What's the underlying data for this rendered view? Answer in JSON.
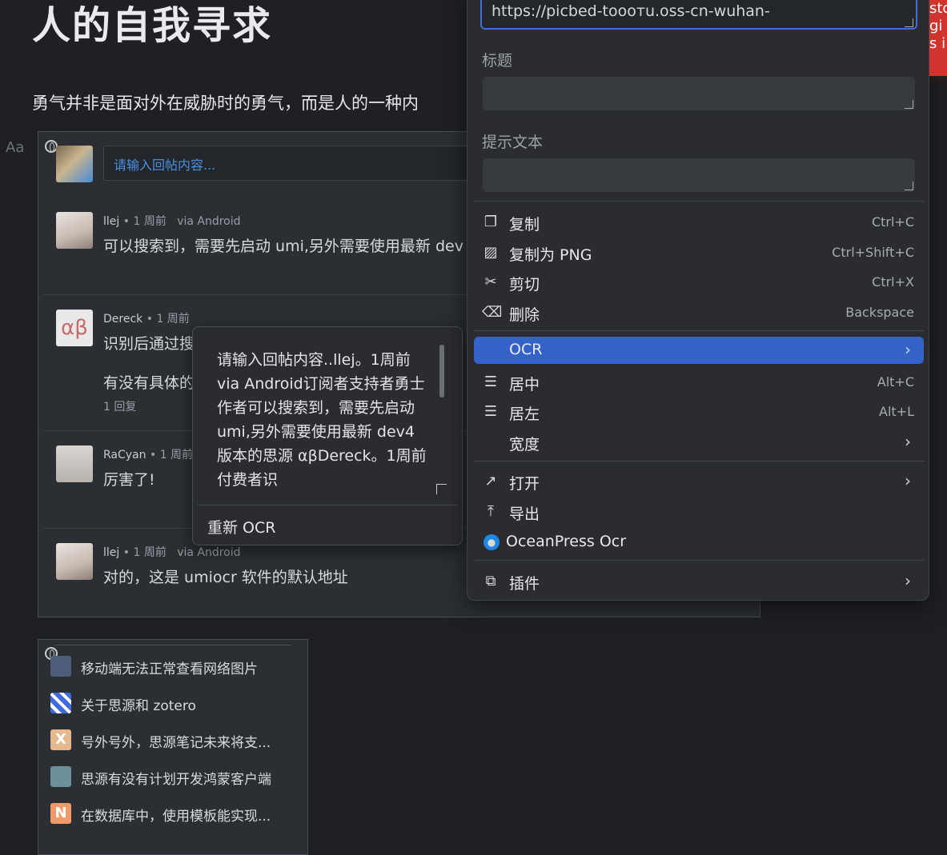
{
  "document": {
    "heading": "人的自我寻求",
    "paragraph": "勇气并非是面对外在威胁时的勇气，而是人的一种内",
    "font_size_indicator": "Aa"
  },
  "comments_embed": {
    "reply_placeholder": "请输入回帖内容...",
    "comments": [
      {
        "author": "llej",
        "time": "1 周前",
        "via": "via Android",
        "body": "可以搜索到，需要先启动 umi,另外需要使用最新 dev"
      },
      {
        "author": "Dereck",
        "time": "1 周前",
        "body": "识别后通过搜",
        "body2": "有没有具体的",
        "replies": "1 回复"
      },
      {
        "author": "RaCyan",
        "time": "1 周前",
        "body": "厉害了!"
      },
      {
        "author": "llej",
        "time": "1 周前",
        "via": "via Android",
        "body": "对的，这是 umiocr 软件的默认地址"
      }
    ]
  },
  "list_embed": {
    "items": [
      {
        "label": "移动端无法正常查看网络图片",
        "color": "#4d5d7a"
      },
      {
        "label": "关于思源和 zotero",
        "color": "#3f6bdc"
      },
      {
        "label": "号外号外，思源笔记未来将支...",
        "color": "#e5b98d",
        "letter": "X"
      },
      {
        "label": "思源有没有计划开发鸿蒙客户端",
        "color": "#6f8f9b"
      },
      {
        "label": "在数据库中，使用模板能实现...",
        "color": "#f09a6a",
        "letter": "N"
      }
    ]
  },
  "ocr_popup": {
    "text": "请输入回帖内容..llej。1周前via Android订阅者支持者勇士作者可以搜索到，需要先启动 umi,另外需要使用最新 dev4 版本的思源 αβDereck。1周前付费者识",
    "reocr_label": "重新 OCR"
  },
  "context_menu": {
    "url_value": "https://picbed-tooотu.oss-cn-wuhan-",
    "title_label": "标题",
    "alt_label": "提示文本",
    "items": [
      {
        "label": "复制",
        "shortcut": "Ctrl+C",
        "icon": "copy-icon",
        "glyph": "❐"
      },
      {
        "label": "复制为 PNG",
        "shortcut": "Ctrl+Shift+C",
        "icon": "image-icon",
        "glyph": "🖼"
      },
      {
        "label": "剪切",
        "shortcut": "Ctrl+X",
        "icon": "scissors-icon",
        "glyph": "✂"
      },
      {
        "label": "删除",
        "shortcut": "Backspace",
        "icon": "trash-icon",
        "glyph": "🗑"
      },
      {
        "label": "OCR",
        "arrow": "›",
        "active": true
      },
      {
        "label": "居中",
        "shortcut": "Alt+C",
        "icon": "align-center-icon",
        "glyph": "☰"
      },
      {
        "label": "居左",
        "shortcut": "Alt+L",
        "icon": "align-left-icon",
        "glyph": "☰"
      },
      {
        "label": "宽度",
        "arrow": "›"
      },
      {
        "label": "打开",
        "arrow": "›",
        "icon": "external-link-icon",
        "glyph": "↗"
      },
      {
        "label": "导出",
        "icon": "export-icon",
        "glyph": "⤒"
      },
      {
        "label": "OceanPress Ocr",
        "icon": "oceanpress-icon",
        "glyph": "🐬"
      },
      {
        "label": "插件",
        "arrow": "›",
        "icon": "plugin-icon",
        "glyph": "⧉"
      }
    ]
  },
  "side_strip": {
    "text": "sto\ngi\ns i"
  }
}
